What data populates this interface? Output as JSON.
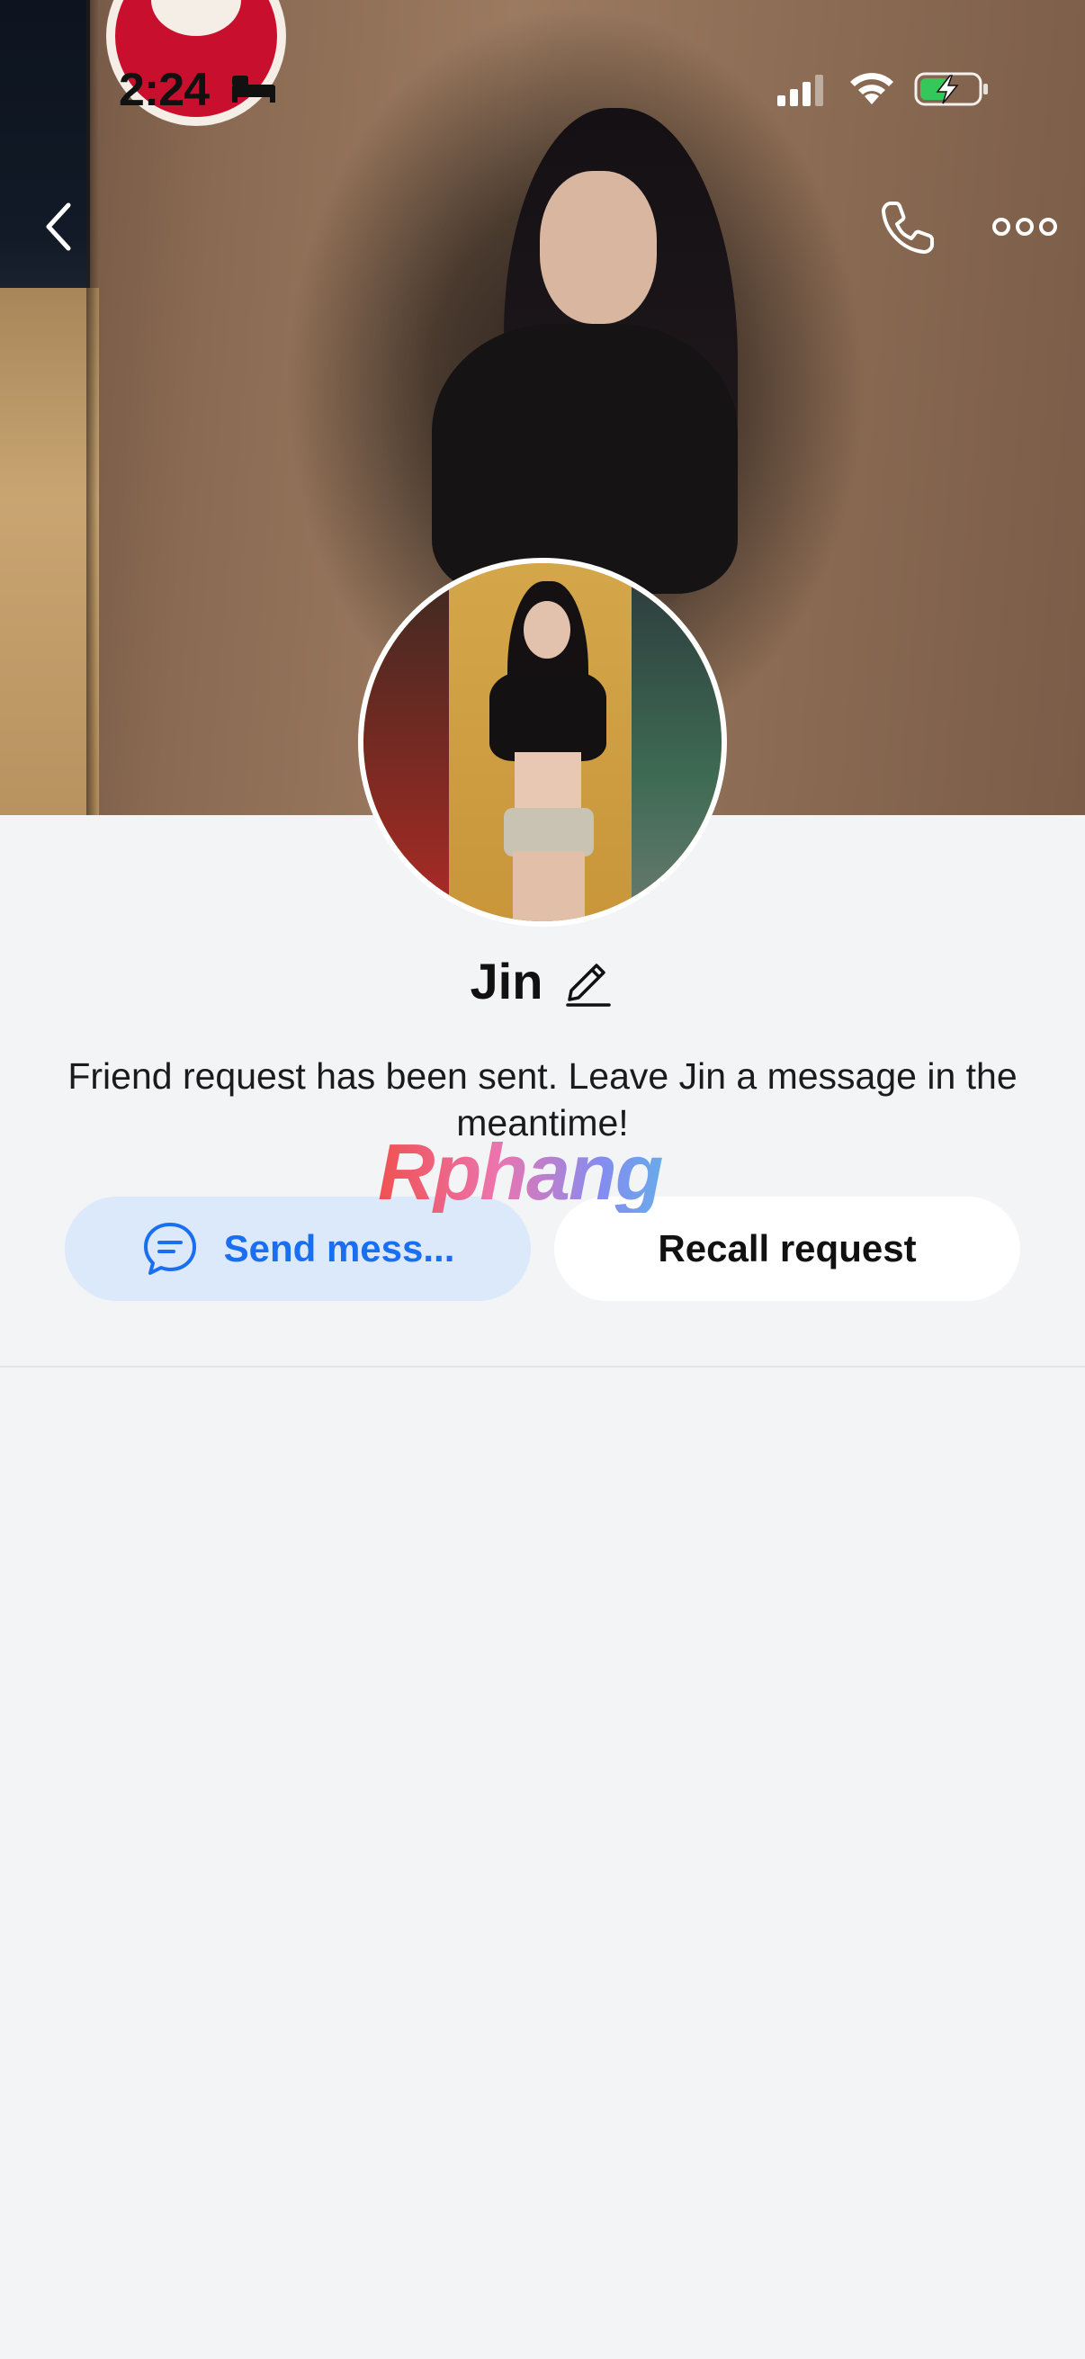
{
  "status_bar": {
    "time": "2:24",
    "icons": [
      "sleep-focus-icon",
      "cellular-signal-icon",
      "wifi-icon",
      "battery-charging-icon"
    ],
    "battery_color": "#34c759"
  },
  "nav": {
    "icons": [
      "back-chevron-icon",
      "phone-call-icon",
      "more-options-icon"
    ]
  },
  "profile": {
    "name": "Jin",
    "status_message": "Friend request has been sent. Leave Jin a message in the meantime!"
  },
  "watermark": {
    "text": "Rphang"
  },
  "actions": {
    "send_message_label": "Send mess...",
    "recall_request_label": "Recall request",
    "accent_color": "#1a6ff0",
    "send_button_bg": "#dbe9fb"
  }
}
